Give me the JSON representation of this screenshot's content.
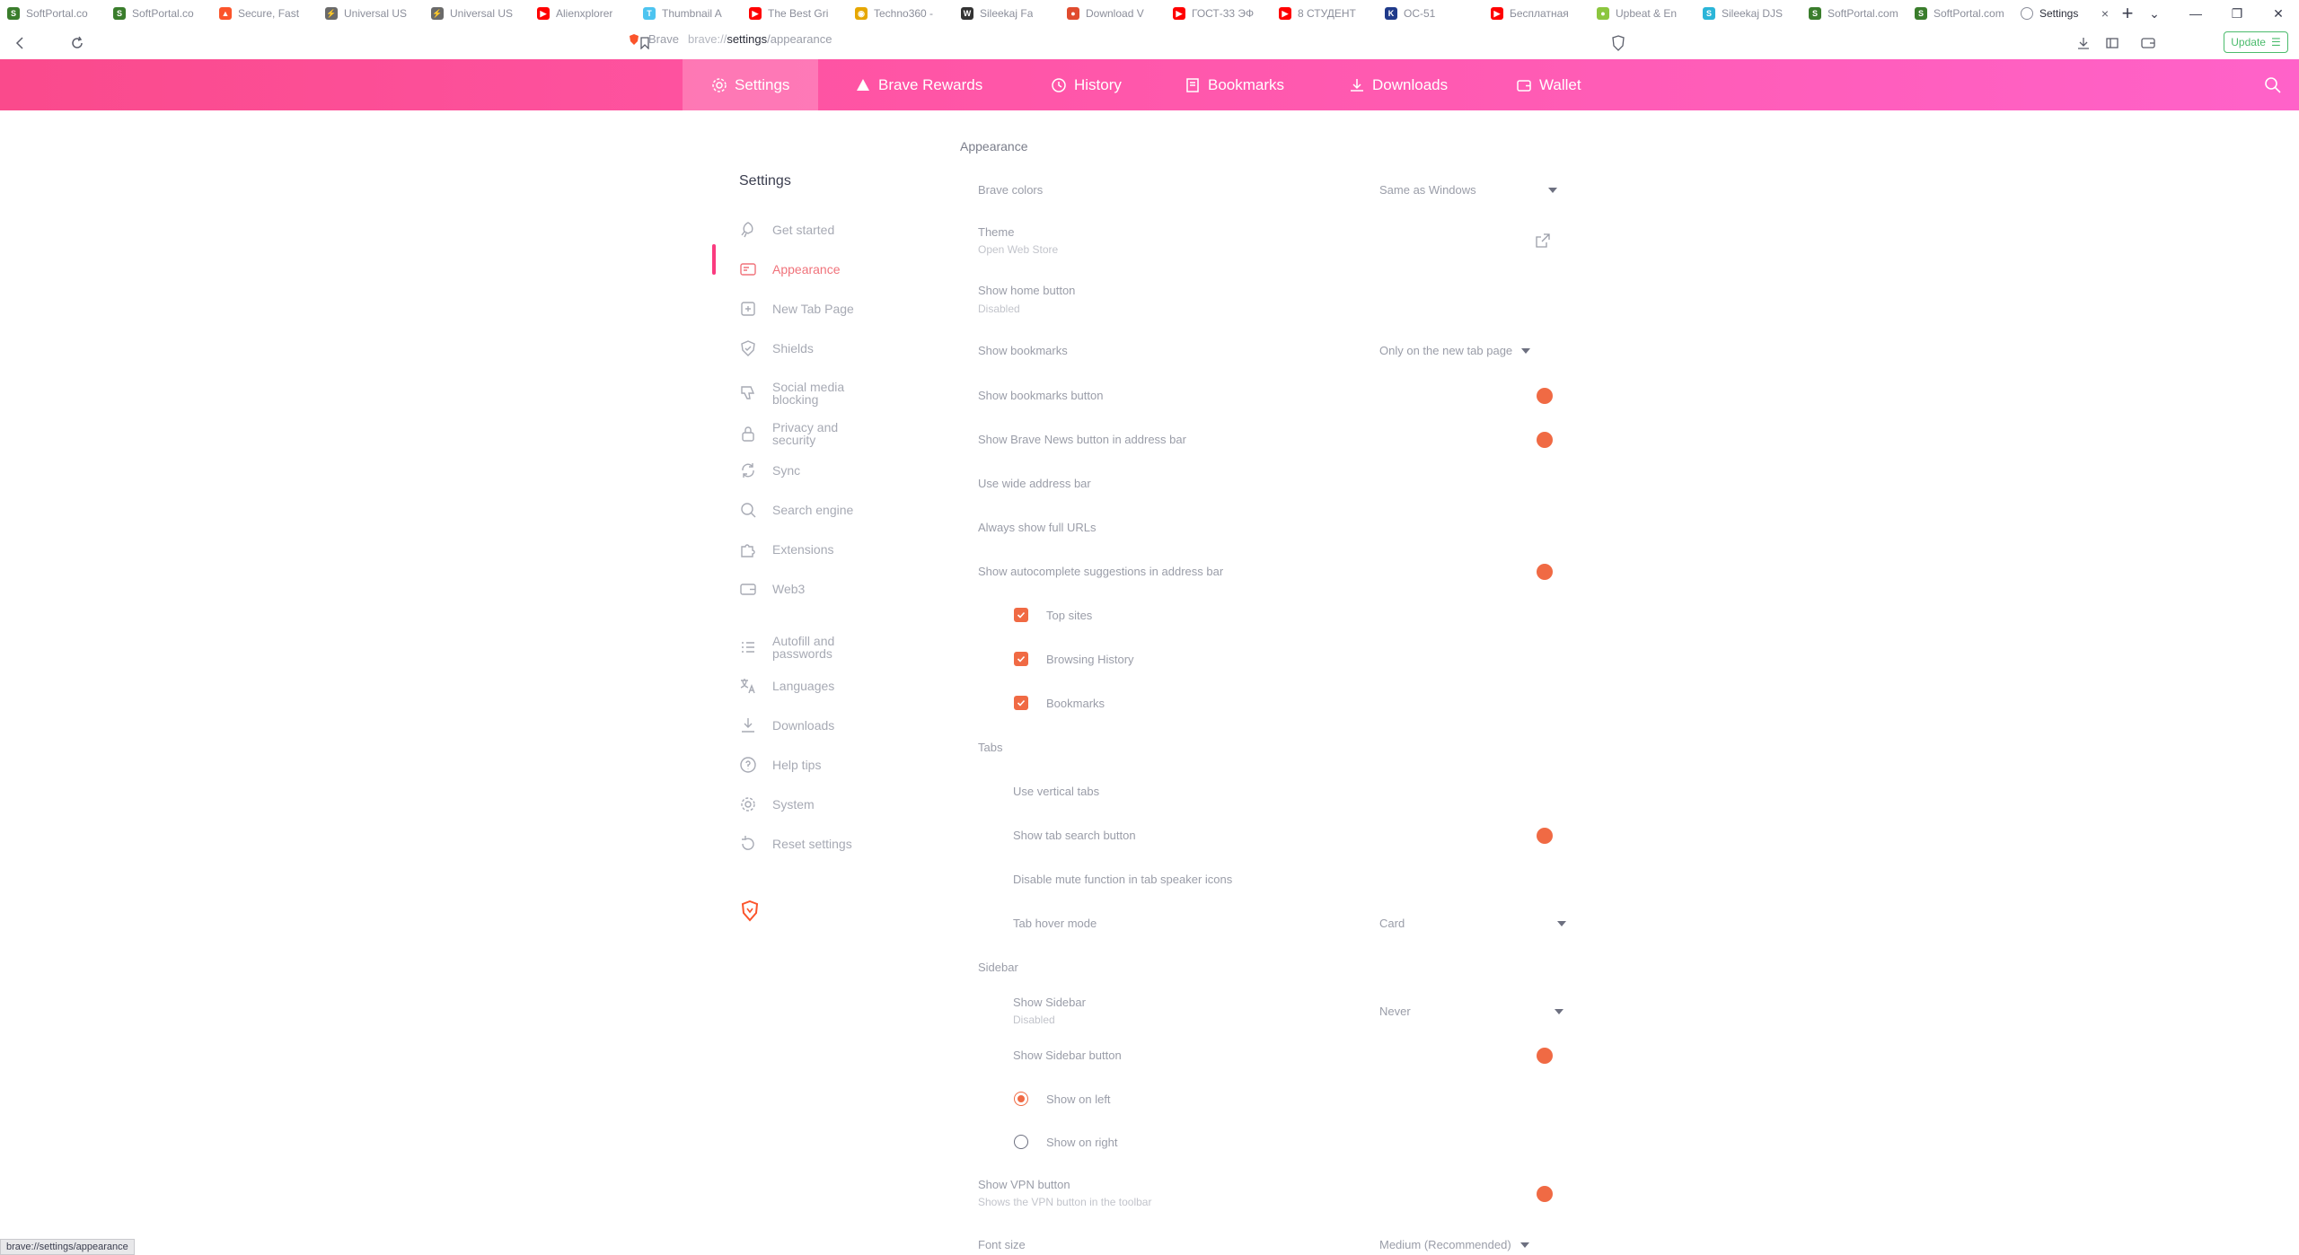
{
  "tabs": [
    {
      "title": "SoftPortal.co",
      "color": "#3a7d2c",
      "glyph": "S"
    },
    {
      "title": "SoftPortal.co",
      "color": "#3a7d2c",
      "glyph": "S"
    },
    {
      "title": "Secure, Fast",
      "color": "#fb542b",
      "glyph": "▲"
    },
    {
      "title": "Universal US",
      "color": "#6a6a6a",
      "glyph": "⚡"
    },
    {
      "title": "Universal US",
      "color": "#6a6a6a",
      "glyph": "⚡"
    },
    {
      "title": "Alienxplorer",
      "color": "#ff0000",
      "glyph": "▶"
    },
    {
      "title": "Thumbnail A",
      "color": "#4dc4f0",
      "glyph": "T"
    },
    {
      "title": "The Best Gri",
      "color": "#ff0000",
      "glyph": "▶"
    },
    {
      "title": "Techno360 -",
      "color": "#e6a700",
      "glyph": "◉"
    },
    {
      "title": "Sileekaj Fa",
      "color": "#333333",
      "glyph": "W"
    },
    {
      "title": "Download V",
      "color": "#e04b2e",
      "glyph": "●"
    },
    {
      "title": "ГОСТ-33 ЭФ",
      "color": "#ff0000",
      "glyph": "▶"
    },
    {
      "title": "8 СТУДЕНТ",
      "color": "#ff0000",
      "glyph": "▶"
    },
    {
      "title": "ОС-51",
      "color": "#1f3a8a",
      "glyph": "K"
    },
    {
      "title": "Бесплатная",
      "color": "#ff0000",
      "glyph": "▶"
    },
    {
      "title": "Upbeat & En",
      "color": "#8cc63f",
      "glyph": "●"
    },
    {
      "title": "Sileekaj DJS",
      "color": "#2bb5d8",
      "glyph": "S"
    },
    {
      "title": "SoftPortal.com",
      "color": "#3a7d2c",
      "glyph": "S"
    },
    {
      "title": "SoftPortal.com",
      "color": "#3a7d2c",
      "glyph": "S"
    }
  ],
  "active_tab": {
    "title": "Settings",
    "close": "×"
  },
  "window_controls": {
    "minimize": "—",
    "restore": "❐",
    "close": "✕",
    "tab_search": "⌄",
    "new_tab": "+"
  },
  "address": {
    "brand": "Brave",
    "scheme": "brave://",
    "host": "settings",
    "path": "/appearance"
  },
  "update_button": {
    "label": "Update",
    "menu": "☰"
  },
  "nav": [
    {
      "label": "Settings",
      "icon": "gear-icon"
    },
    {
      "label": "Brave Rewards",
      "icon": "rewards-triangle-icon"
    },
    {
      "label": "History",
      "icon": "history-icon"
    },
    {
      "label": "Bookmarks",
      "icon": "bookmarks-icon"
    },
    {
      "label": "Downloads",
      "icon": "download-icon"
    },
    {
      "label": "Wallet",
      "icon": "wallet-icon"
    }
  ],
  "sidebar": {
    "title": "Settings",
    "items": [
      {
        "label": "Get started",
        "icon": "rocket-icon"
      },
      {
        "label": "Appearance",
        "icon": "appearance-icon",
        "active": true
      },
      {
        "label": "New Tab Page",
        "icon": "new-tab-icon"
      },
      {
        "label": "Shields",
        "icon": "shield-icon"
      },
      {
        "label": "Social media blocking",
        "icon": "thumbs-down-icon"
      },
      {
        "label": "Privacy and security",
        "icon": "lock-icon"
      },
      {
        "label": "Sync",
        "icon": "sync-icon"
      },
      {
        "label": "Search engine",
        "icon": "search-icon"
      },
      {
        "label": "Extensions",
        "icon": "puzzle-icon"
      },
      {
        "label": "Web3",
        "icon": "wallet-icon"
      },
      {
        "label": "Autofill and passwords",
        "icon": "list-icon"
      },
      {
        "label": "Languages",
        "icon": "translate-icon"
      },
      {
        "label": "Downloads",
        "icon": "download-icon"
      },
      {
        "label": "Help tips",
        "icon": "help-icon"
      },
      {
        "label": "System",
        "icon": "gear-icon"
      },
      {
        "label": "Reset settings",
        "icon": "reset-icon"
      }
    ]
  },
  "content": {
    "section_appearance": "Appearance",
    "brave_colors": {
      "label": "Brave colors",
      "value": "Same as Windows"
    },
    "theme": {
      "label": "Theme",
      "sub": "Open Web Store"
    },
    "home_button": {
      "label": "Show home button",
      "sub": "Disabled"
    },
    "bookmarks": {
      "label": "Show bookmarks",
      "value": "Only on the new tab page"
    },
    "bookmarks_button": {
      "label": "Show bookmarks button"
    },
    "news_button": {
      "label": "Show Brave News button in address bar"
    },
    "wide_address": {
      "label": "Use wide address bar"
    },
    "full_urls": {
      "label": "Always show full URLs"
    },
    "autocomplete": {
      "label": "Show autocomplete suggestions in address bar"
    },
    "top_sites": {
      "label": "Top sites"
    },
    "browsing_history": {
      "label": "Browsing History"
    },
    "bookmarks_check": {
      "label": "Bookmarks"
    },
    "section_tabs": "Tabs",
    "vertical_tabs": {
      "label": "Use vertical tabs"
    },
    "tab_search": {
      "label": "Show tab search button"
    },
    "mute": {
      "label": "Disable mute function in tab speaker icons"
    },
    "tab_hover": {
      "label": "Tab hover mode",
      "value": "Card"
    },
    "section_sidebar": "Sidebar",
    "show_sidebar": {
      "label": "Show Sidebar",
      "sub": "Disabled",
      "value": "Never"
    },
    "sidebar_button": {
      "label": "Show Sidebar button"
    },
    "show_left": {
      "label": "Show on left"
    },
    "show_right": {
      "label": "Show on right"
    },
    "vpn_button": {
      "label": "Show VPN button",
      "sub": "Shows the VPN button in the toolbar"
    },
    "font_size": {
      "label": "Font size",
      "value": "Medium (Recommended)"
    }
  },
  "status_url": "brave://settings/appearance",
  "colors": {
    "accent": "#f06a44",
    "nav_pink": "#ff55a6",
    "active_bar": "#fa3b7f"
  }
}
